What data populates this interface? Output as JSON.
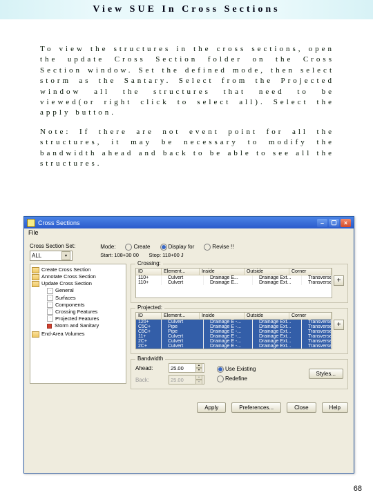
{
  "page": {
    "title": "View SUE In Cross Sections",
    "para1": "To view the structures in the cross sections, open the update Cross Section folder on the Cross Section window. Set the defined mode, then select storm as the Santary. Select from the Projected window all the structures that need to be viewed(or right click to select all). Select the apply button.",
    "para2": "Note: If there are not event point for all the structures, it may be necessary to modify the bandwidth ahead and back to be able to see all the structures.",
    "pagenum": "68"
  },
  "win": {
    "title": "Cross Sections",
    "menu_file": "File",
    "cross_section_set": "Cross Section Set:",
    "set_value": "ALL",
    "mode_label": "Mode:",
    "mode_create": "Create",
    "mode_display": "Display for",
    "mode_revise": "Revise !!",
    "start_label": "Start:",
    "start_value": "108+30 00",
    "stop_label": "Stop:",
    "stop_value": "118+00 J",
    "tree": {
      "create": "Create Cross Section",
      "annotate": "Annotate Cross Section",
      "update": "Update Cross Section",
      "general": "General",
      "surfaces": "Surfaces",
      "components": "Components",
      "crossing": "Crossing Features",
      "projected": "Projected Features",
      "storm": "Storm and Sanitary",
      "endarea": "End-Area Volumes"
    },
    "crossing_box": "Crossing:",
    "projected_box": "Projected:",
    "cols": {
      "id": "ID",
      "elem": "Element...",
      "inside": "Inside",
      "outside": "Outside",
      "corner": "Corner"
    },
    "cross_rows": [
      {
        "id": "110+",
        "elem": "Culvert",
        "inside": "Drainage E...",
        "outside": "Drainage Ext...",
        "corner": "Transverse F..."
      },
      {
        "id": "110+",
        "elem": "Culvert",
        "inside": "Drainage E...",
        "outside": "Drainage Ext...",
        "corner": "Transverse F..."
      }
    ],
    "proj_rows": [
      {
        "id": "120+",
        "elem": "Culvert",
        "inside": "Drainage E -...",
        "outside": "Drainage Ext...",
        "corner": "Transverse F..."
      },
      {
        "id": "C5C+",
        "elem": "Pipe",
        "inside": "Drainage E -...",
        "outside": "Drainage Ext...",
        "corner": "Transverse F..."
      },
      {
        "id": "C5C+",
        "elem": "Pipe",
        "inside": "Drainage E -...",
        "outside": "Drainage Ext...",
        "corner": "Transverse F..."
      },
      {
        "id": "11+",
        "elem": "Culvert",
        "inside": "Drainage E -...",
        "outside": "Drainage Ext...",
        "corner": "Transverse F..."
      },
      {
        "id": "2C+",
        "elem": "Culvert",
        "inside": "Drainage E -...",
        "outside": "Drainage Ext...",
        "corner": "Transverse F..."
      },
      {
        "id": "2C+",
        "elem": "Culvert",
        "inside": "Drainage E -...",
        "outside": "Drainage Ext...",
        "corner": "Transverse F..."
      }
    ],
    "bw_label": "Bandwidth",
    "ahead": "Ahead:",
    "ahead_val": "25.00",
    "back": "Back:",
    "back_val": "25.00",
    "use_existing": "Use Existing",
    "redefine": "Redefine",
    "styles": "Styles...",
    "apply": "Apply",
    "prefs": "Preferences...",
    "close": "Close",
    "help": "Help"
  }
}
